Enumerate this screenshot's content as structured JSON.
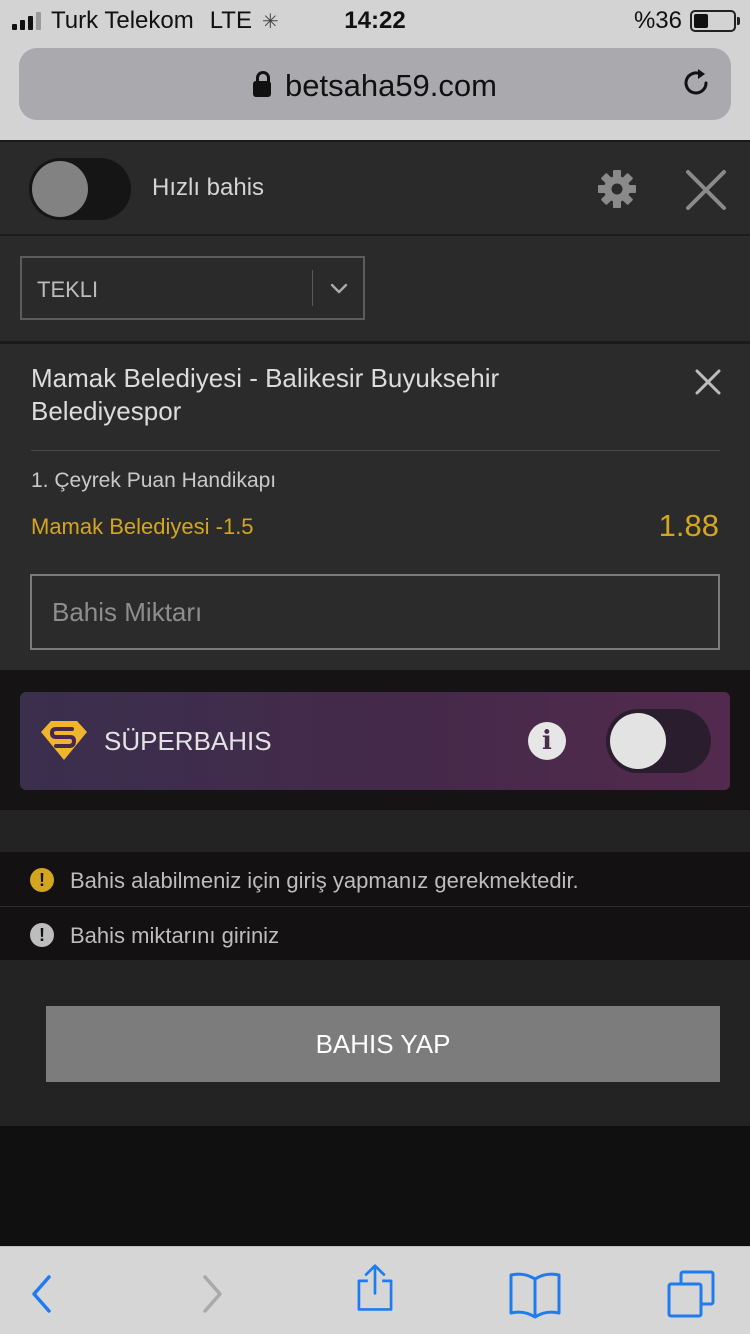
{
  "status_bar": {
    "carrier": "Turk Telekom",
    "network": "LTE",
    "time": "14:22",
    "battery": "%36",
    "battery_level": 0.36
  },
  "browser": {
    "url": "betsaha59.com"
  },
  "betslip": {
    "quick_bet_label": "Hızlı bahis",
    "quick_bet_enabled": false,
    "bet_type": "TEKLI",
    "bet": {
      "match": "Mamak Belediyesi - Balikesir Buyuksehir Belediyespor",
      "market": "1. Çeyrek Puan Handikapı",
      "selection": "Mamak Belediyesi -1.5",
      "odds": "1.88"
    },
    "stake_placeholder": "Bahis Miktarı",
    "stake_value": "",
    "superbet": {
      "label": "SÜPERBAHIS",
      "enabled": false
    },
    "warnings": [
      {
        "text": "Bahis alabilmeniz için giriş yapmanız gerekmektedir.",
        "level": "warning",
        "color": "#d4a520"
      },
      {
        "text": "Bahis miktarını giriniz",
        "level": "info",
        "color": "#bdbdbd"
      }
    ],
    "place_bet_label": "BAHIS YAP"
  },
  "colors": {
    "accent": "#d4a520",
    "ios_blue": "#1e7cf0",
    "panel": "#2b2b2b"
  }
}
